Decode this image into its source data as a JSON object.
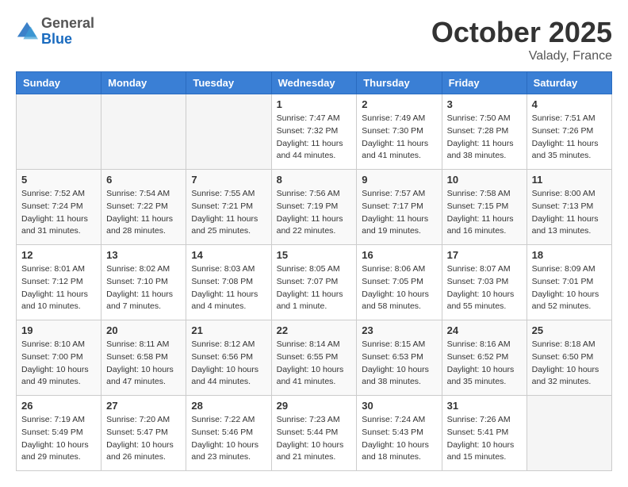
{
  "header": {
    "logo_general": "General",
    "logo_blue": "Blue",
    "month_title": "October 2025",
    "location": "Valady, France"
  },
  "weekdays": [
    "Sunday",
    "Monday",
    "Tuesday",
    "Wednesday",
    "Thursday",
    "Friday",
    "Saturday"
  ],
  "weeks": [
    [
      {
        "day": "",
        "empty": true
      },
      {
        "day": "",
        "empty": true
      },
      {
        "day": "",
        "empty": true
      },
      {
        "day": "1",
        "sunrise": "7:47 AM",
        "sunset": "7:32 PM",
        "daylight": "11 hours and 44 minutes."
      },
      {
        "day": "2",
        "sunrise": "7:49 AM",
        "sunset": "7:30 PM",
        "daylight": "11 hours and 41 minutes."
      },
      {
        "day": "3",
        "sunrise": "7:50 AM",
        "sunset": "7:28 PM",
        "daylight": "11 hours and 38 minutes."
      },
      {
        "day": "4",
        "sunrise": "7:51 AM",
        "sunset": "7:26 PM",
        "daylight": "11 hours and 35 minutes."
      }
    ],
    [
      {
        "day": "5",
        "sunrise": "7:52 AM",
        "sunset": "7:24 PM",
        "daylight": "11 hours and 31 minutes."
      },
      {
        "day": "6",
        "sunrise": "7:54 AM",
        "sunset": "7:22 PM",
        "daylight": "11 hours and 28 minutes."
      },
      {
        "day": "7",
        "sunrise": "7:55 AM",
        "sunset": "7:21 PM",
        "daylight": "11 hours and 25 minutes."
      },
      {
        "day": "8",
        "sunrise": "7:56 AM",
        "sunset": "7:19 PM",
        "daylight": "11 hours and 22 minutes."
      },
      {
        "day": "9",
        "sunrise": "7:57 AM",
        "sunset": "7:17 PM",
        "daylight": "11 hours and 19 minutes."
      },
      {
        "day": "10",
        "sunrise": "7:58 AM",
        "sunset": "7:15 PM",
        "daylight": "11 hours and 16 minutes."
      },
      {
        "day": "11",
        "sunrise": "8:00 AM",
        "sunset": "7:13 PM",
        "daylight": "11 hours and 13 minutes."
      }
    ],
    [
      {
        "day": "12",
        "sunrise": "8:01 AM",
        "sunset": "7:12 PM",
        "daylight": "11 hours and 10 minutes."
      },
      {
        "day": "13",
        "sunrise": "8:02 AM",
        "sunset": "7:10 PM",
        "daylight": "11 hours and 7 minutes."
      },
      {
        "day": "14",
        "sunrise": "8:03 AM",
        "sunset": "7:08 PM",
        "daylight": "11 hours and 4 minutes."
      },
      {
        "day": "15",
        "sunrise": "8:05 AM",
        "sunset": "7:07 PM",
        "daylight": "11 hours and 1 minute."
      },
      {
        "day": "16",
        "sunrise": "8:06 AM",
        "sunset": "7:05 PM",
        "daylight": "10 hours and 58 minutes."
      },
      {
        "day": "17",
        "sunrise": "8:07 AM",
        "sunset": "7:03 PM",
        "daylight": "10 hours and 55 minutes."
      },
      {
        "day": "18",
        "sunrise": "8:09 AM",
        "sunset": "7:01 PM",
        "daylight": "10 hours and 52 minutes."
      }
    ],
    [
      {
        "day": "19",
        "sunrise": "8:10 AM",
        "sunset": "7:00 PM",
        "daylight": "10 hours and 49 minutes."
      },
      {
        "day": "20",
        "sunrise": "8:11 AM",
        "sunset": "6:58 PM",
        "daylight": "10 hours and 47 minutes."
      },
      {
        "day": "21",
        "sunrise": "8:12 AM",
        "sunset": "6:56 PM",
        "daylight": "10 hours and 44 minutes."
      },
      {
        "day": "22",
        "sunrise": "8:14 AM",
        "sunset": "6:55 PM",
        "daylight": "10 hours and 41 minutes."
      },
      {
        "day": "23",
        "sunrise": "8:15 AM",
        "sunset": "6:53 PM",
        "daylight": "10 hours and 38 minutes."
      },
      {
        "day": "24",
        "sunrise": "8:16 AM",
        "sunset": "6:52 PM",
        "daylight": "10 hours and 35 minutes."
      },
      {
        "day": "25",
        "sunrise": "8:18 AM",
        "sunset": "6:50 PM",
        "daylight": "10 hours and 32 minutes."
      }
    ],
    [
      {
        "day": "26",
        "sunrise": "7:19 AM",
        "sunset": "5:49 PM",
        "daylight": "10 hours and 29 minutes."
      },
      {
        "day": "27",
        "sunrise": "7:20 AM",
        "sunset": "5:47 PM",
        "daylight": "10 hours and 26 minutes."
      },
      {
        "day": "28",
        "sunrise": "7:22 AM",
        "sunset": "5:46 PM",
        "daylight": "10 hours and 23 minutes."
      },
      {
        "day": "29",
        "sunrise": "7:23 AM",
        "sunset": "5:44 PM",
        "daylight": "10 hours and 21 minutes."
      },
      {
        "day": "30",
        "sunrise": "7:24 AM",
        "sunset": "5:43 PM",
        "daylight": "10 hours and 18 minutes."
      },
      {
        "day": "31",
        "sunrise": "7:26 AM",
        "sunset": "5:41 PM",
        "daylight": "10 hours and 15 minutes."
      },
      {
        "day": "",
        "empty": true
      }
    ]
  ]
}
